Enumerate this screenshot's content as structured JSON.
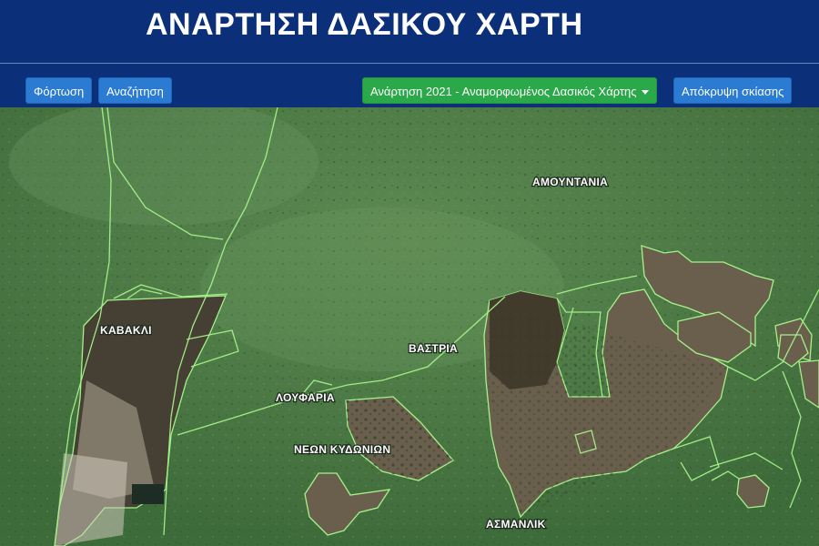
{
  "header": {
    "title": "ΑΝΑΡΤΗΣΗ ΔΑΣΙΚΟΥ ΧΑΡΤΗ"
  },
  "toolbar": {
    "load_label": "Φόρτωση",
    "search_label": "Αναζήτηση",
    "posting_label": "Ανάρτηση 2021 - Αναμορφωμένος Δασικός Χάρτης",
    "hide_shading_label": "Απόκρυψη σκίασης"
  },
  "map": {
    "labels": {
      "amountania": "ΑΜΟΥΝΤΑΝΙΑ",
      "kavakli": "ΚΑΒΑΚΛΙ",
      "vastria": "ΒΑΣΤΡΙΑ",
      "loufaria": "ΛΟΥΦΑΡΙΑ",
      "neon_kydonion": "ΝΕΩΝ ΚΥΔΩΝΙΩΝ",
      "asmanlik": "ΑΣΜΑΝΛΙΚ"
    },
    "colors": {
      "header_bg": "#0b2f78",
      "button_blue": "#2a7bd1",
      "button_green": "#2aa84a",
      "boundary": "#a5f28a",
      "forest": "#4d7a45"
    }
  }
}
